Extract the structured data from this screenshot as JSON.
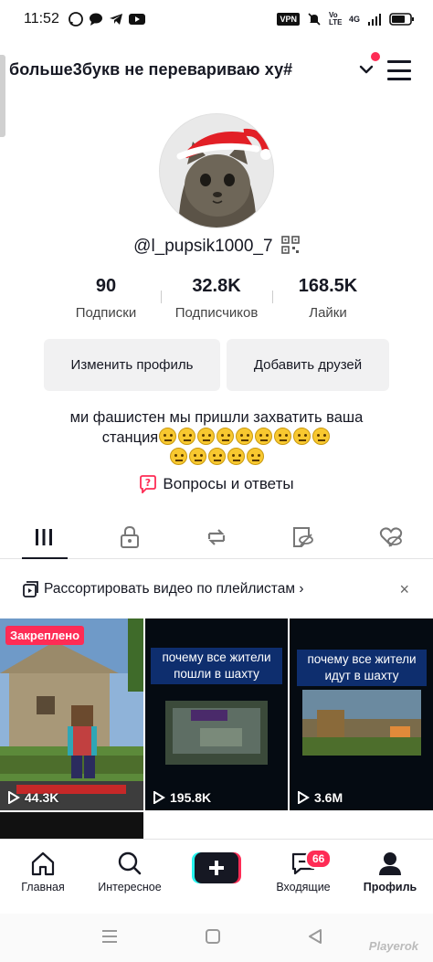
{
  "status_bar": {
    "time": "11:52",
    "vpn": "VPN",
    "signal_text": "Vo LTE",
    "network": "4G"
  },
  "header": {
    "display_name": "больше3букв не перевариваю ху#"
  },
  "profile": {
    "username": "@l_pupsik1000_7",
    "stats": [
      {
        "value": "90",
        "label": "Подписки"
      },
      {
        "value": "32.8K",
        "label": "Подписчиков"
      },
      {
        "value": "168.5K",
        "label": "Лайки"
      }
    ],
    "edit_button": "Изменить профиль",
    "add_friends_button": "Добавить друзей",
    "bio_text_line1": "ми фашистен мы пришли захватить ваша",
    "bio_text_line2_prefix": "станция",
    "bio_emoji_count": 14,
    "qa_label": "Вопросы и ответы"
  },
  "playlist_bar": {
    "label": "Рассортировать видео по плейлистам ›",
    "close": "×"
  },
  "videos": [
    {
      "pinned_label": "Закреплено",
      "views": "44.3K",
      "caption": ""
    },
    {
      "pinned_label": "",
      "views": "195.8K",
      "caption": "почему все жители пошли в шахту"
    },
    {
      "pinned_label": "",
      "views": "3.6M",
      "caption": "почему все жители идут в шахту"
    }
  ],
  "bottom_nav": {
    "home": "Главная",
    "discover": "Интересное",
    "inbox": "Входящие",
    "inbox_badge": "66",
    "profile": "Профиль"
  },
  "watermark": "Playerok",
  "colors": {
    "accent": "#fe2c55",
    "text": "#161823",
    "button_bg": "#f1f1f2",
    "caption_bg": "#0e2e6e"
  }
}
